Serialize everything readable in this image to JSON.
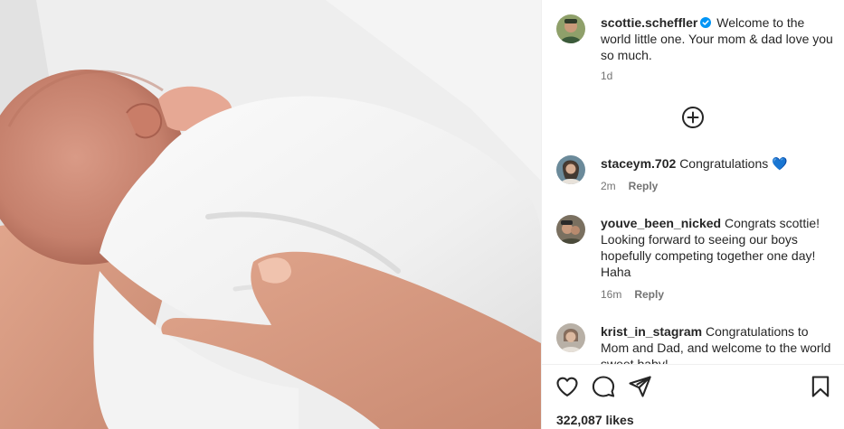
{
  "post": {
    "author": "scottie.scheffler",
    "caption": "Welcome to the world little one. Your mom & dad love you so much.",
    "time": "1d",
    "likes": "322,087 likes"
  },
  "comments": [
    {
      "user": "staceym.702",
      "text": "Congratulations 💙",
      "time": "2m",
      "reply": "Reply"
    },
    {
      "user": "youve_been_nicked",
      "text": "Congrats scottie! Looking forward to seeing our boys hopefully competing together one day! Haha",
      "time": "16m",
      "reply": "Reply"
    },
    {
      "user": "krist_in_stagram",
      "text": "Congratulations to Mom and Dad, and welcome to the world sweet baby!",
      "time": "",
      "reply": ""
    }
  ],
  "icons": {
    "verified": "verified-badge-icon",
    "load_more": "plus-circle-icon",
    "like": "heart-icon",
    "comment": "comment-icon",
    "share": "paper-plane-icon",
    "save": "bookmark-icon"
  },
  "colors": {
    "text": "#262626",
    "secondary": "#737373",
    "verified": "#0095f6",
    "divider": "#efefef"
  }
}
